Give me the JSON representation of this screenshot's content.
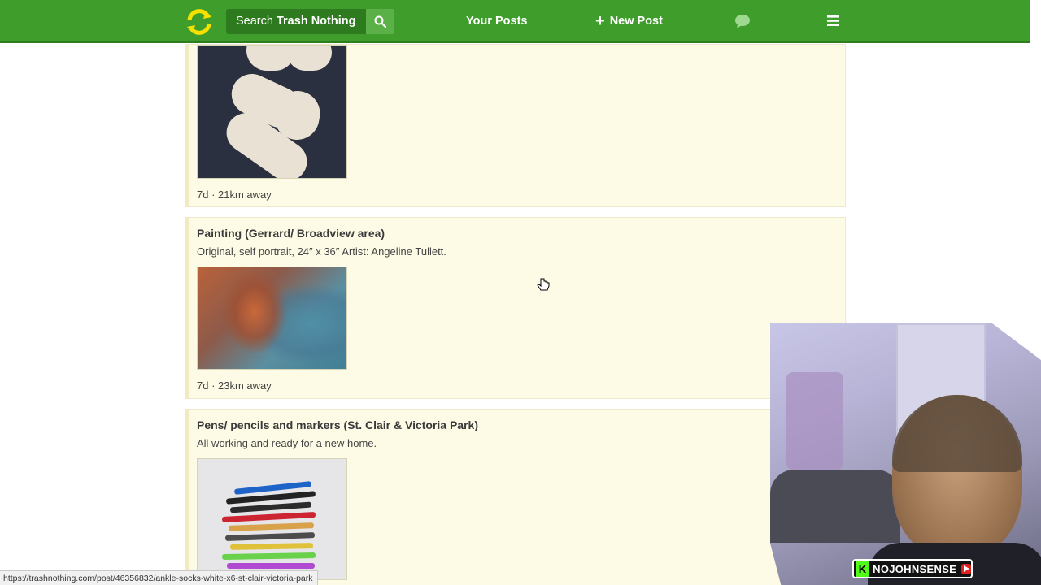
{
  "header": {
    "logo_alt": "Trash Nothing",
    "search_prefix": "Search",
    "search_brand": "Trash Nothing",
    "your_posts": "Your Posts",
    "new_post": "New Post",
    "brand_color": "#3f9e2b"
  },
  "listings": [
    {
      "title": "",
      "description": "",
      "meta": "7d · 21km away",
      "image": "socks-photo"
    },
    {
      "title": "Painting (Gerrard/ Broadview area)",
      "description": "Original, self portrait, 24″ x 36″ Artist: Angeline Tullett.",
      "meta": "7d · 23km away",
      "image": "painting-photo"
    },
    {
      "title": "Pens/ pencils and markers (St. Clair & Victoria Park)",
      "description": "All working and ready for a new home.",
      "meta": "",
      "image": "pens-photo"
    }
  ],
  "overlay": {
    "channel_name": "NOJOHNSENSE",
    "badge_letter": "K"
  },
  "statusbar": {
    "url": "https://trashnothing.com/post/46356832/ankle-socks-white-x6-st-clair-victoria-park"
  }
}
